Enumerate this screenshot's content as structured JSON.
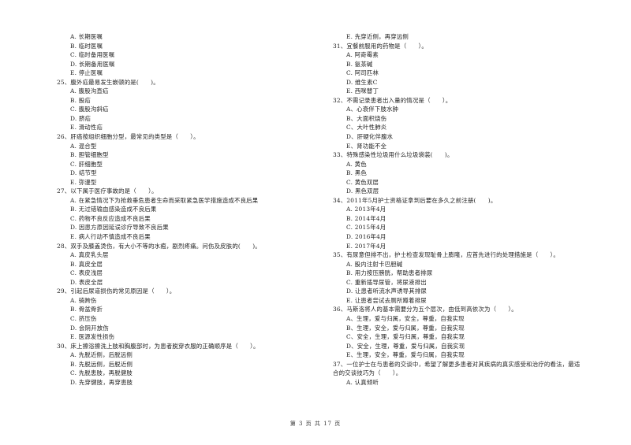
{
  "left_column": [
    {
      "type": "opt",
      "text": "A. 长期医嘱"
    },
    {
      "type": "opt",
      "text": "B. 临时医嘱"
    },
    {
      "type": "opt",
      "text": "C. 临时备用医嘱"
    },
    {
      "type": "opt",
      "text": "D. 长期备用医嘱"
    },
    {
      "type": "opt",
      "text": "E. 停止医嘱"
    },
    {
      "type": "q",
      "text": "25、腹外疝最易发生嵌顿的是(　　)。"
    },
    {
      "type": "opt",
      "text": "A. 腹股沟直疝"
    },
    {
      "type": "opt",
      "text": "B. 股疝"
    },
    {
      "type": "opt",
      "text": "C. 腹股沟斜疝"
    },
    {
      "type": "opt",
      "text": "D. 脐疝"
    },
    {
      "type": "opt",
      "text": "E. 滑动性疝"
    },
    {
      "type": "q",
      "text": "26、肝癌按组织细胞分型，最常见的类型是（　　）。"
    },
    {
      "type": "opt",
      "text": "A. 混合型"
    },
    {
      "type": "opt",
      "text": "B. 胆管细胞型"
    },
    {
      "type": "opt",
      "text": "C. 肝细胞型"
    },
    {
      "type": "opt",
      "text": "D. 结节型"
    },
    {
      "type": "opt",
      "text": "E. 弥漫型"
    },
    {
      "type": "q",
      "text": "27、以下属于医疗事故的是（　　）。"
    },
    {
      "type": "opt",
      "text": "A. 在紧急情况下为抢救垂危患者生命而采取紧急医学措施造成不良后果"
    },
    {
      "type": "opt",
      "text": "B. 无过错输血感染造成不良后果"
    },
    {
      "type": "opt",
      "text": "C. 药物不良反应造成不良后果"
    },
    {
      "type": "opt",
      "text": "D. 因患方原因延误诊疗导致不良后果"
    },
    {
      "type": "opt",
      "text": "E. 病人行动不慎造成不良后果"
    },
    {
      "type": "q",
      "text": "28、双手及膝盖烫伤，有大小不等的水疱，剧烈疼痛。问伤及皮肤的(　　)。"
    },
    {
      "type": "opt",
      "text": "A. 真皮乳头层"
    },
    {
      "type": "opt",
      "text": "B. 真皮全层"
    },
    {
      "type": "opt",
      "text": "C. 表皮浅层"
    },
    {
      "type": "opt",
      "text": "D. 表皮全层"
    },
    {
      "type": "q",
      "text": "29、引起后尿道损伤的常见原因是（　　）。"
    },
    {
      "type": "opt",
      "text": "A. 骑跨伤"
    },
    {
      "type": "opt",
      "text": "B. 骨盆骨折"
    },
    {
      "type": "opt",
      "text": "C. 挤压伤"
    },
    {
      "type": "opt",
      "text": "D. 会阴开放伤"
    },
    {
      "type": "opt",
      "text": "E. 医源发性损伤"
    },
    {
      "type": "q",
      "text": "30、床上擦浴擦洗上肢和胸腹部时，为患者脱穿衣服的正确顺序是（　　）。"
    },
    {
      "type": "opt",
      "text": "A.  先脱近侧，后脱远侧"
    },
    {
      "type": "opt",
      "text": "B.  先脱远侧，后脱近侧"
    },
    {
      "type": "opt",
      "text": "C.  先脱患肢，再脱健肢"
    },
    {
      "type": "opt",
      "text": "D.  先穿健肢，再穿患肢"
    }
  ],
  "right_column": [
    {
      "type": "opt",
      "text": "E.  先穿近侧，再穿远侧"
    },
    {
      "type": "q",
      "text": "31、宜餐前服用的药物是（　　）。"
    },
    {
      "type": "opt",
      "text": "A. 阿奇霉素"
    },
    {
      "type": "opt",
      "text": "B. 氨茶碱"
    },
    {
      "type": "opt",
      "text": "C. 阿司匹林"
    },
    {
      "type": "opt",
      "text": "D. 维生素C"
    },
    {
      "type": "opt",
      "text": "E. 西咪替丁"
    },
    {
      "type": "q",
      "text": "32、不需记录患者出入量的情况是（　　）。"
    },
    {
      "type": "opt",
      "text": "A、心衰伴下肢水肿"
    },
    {
      "type": "opt",
      "text": "B、大面积烧伤"
    },
    {
      "type": "opt",
      "text": "C、大叶性肺炎"
    },
    {
      "type": "opt",
      "text": "D、肝硬化伴腹水"
    },
    {
      "type": "opt",
      "text": "E、肾功能不全"
    },
    {
      "type": "q",
      "text": "33、特殊感染性垃圾用什么垃圾袋装(　　)。"
    },
    {
      "type": "opt",
      "text": "A. 黄色"
    },
    {
      "type": "opt",
      "text": "B. 黑色"
    },
    {
      "type": "opt",
      "text": "C. 黄色双层"
    },
    {
      "type": "opt",
      "text": "D. 黑色双层"
    },
    {
      "type": "q",
      "text": "34、2011年5月护士资格证拿到后要在多久之前注册(　　)。"
    },
    {
      "type": "opt",
      "text": "A. 2013年4月"
    },
    {
      "type": "opt",
      "text": "B. 2014年4月"
    },
    {
      "type": "opt",
      "text": "C. 2015年4月"
    },
    {
      "type": "opt",
      "text": "D. 2016年4月"
    },
    {
      "type": "opt",
      "text": "E. 2017年4月"
    },
    {
      "type": "q",
      "text": "35、有尿意但排不出，护士检查发现耻骨上膨隆，应首先进行的处理措施是（　　）。"
    },
    {
      "type": "opt",
      "text": "A. 股内注射卡巴胆碱"
    },
    {
      "type": "opt",
      "text": "B. 用力按压膀胱，帮助患者排尿"
    },
    {
      "type": "opt",
      "text": "C. 重新插导尿管，将尿液排出"
    },
    {
      "type": "opt",
      "text": "D. 让患者听流水声诱导其排尿"
    },
    {
      "type": "opt",
      "text": "E. 让患者尝试去厕所蹲着排尿"
    },
    {
      "type": "q",
      "text": "36、马斯洛将人的基本需要分为五个层次，由低到高依次为（　　）。"
    },
    {
      "type": "opt",
      "text": "A、生理，爱与归属，安全，尊重，自我实现"
    },
    {
      "type": "opt",
      "text": "B、生理，安全，爱与归属，尊重，自我实现"
    },
    {
      "type": "opt",
      "text": "C、安全，生理，爱与归属，尊重，自我实现"
    },
    {
      "type": "opt",
      "text": "D、安全，生理，尊重，爱与归属，自我实现"
    },
    {
      "type": "opt",
      "text": "E、生理，安全，尊重，爱与归属，自我实现"
    },
    {
      "type": "q",
      "text": "37、一位护士在与患者的交谈中，希望了解更多患者对其疾病的真实感受和治疗的看法，最适"
    },
    {
      "type": "q",
      "text": "合的交谈技巧为（　　）。"
    },
    {
      "type": "opt",
      "text": "A. 认真倾听"
    }
  ],
  "footer": "第 3 页 共 17 页"
}
